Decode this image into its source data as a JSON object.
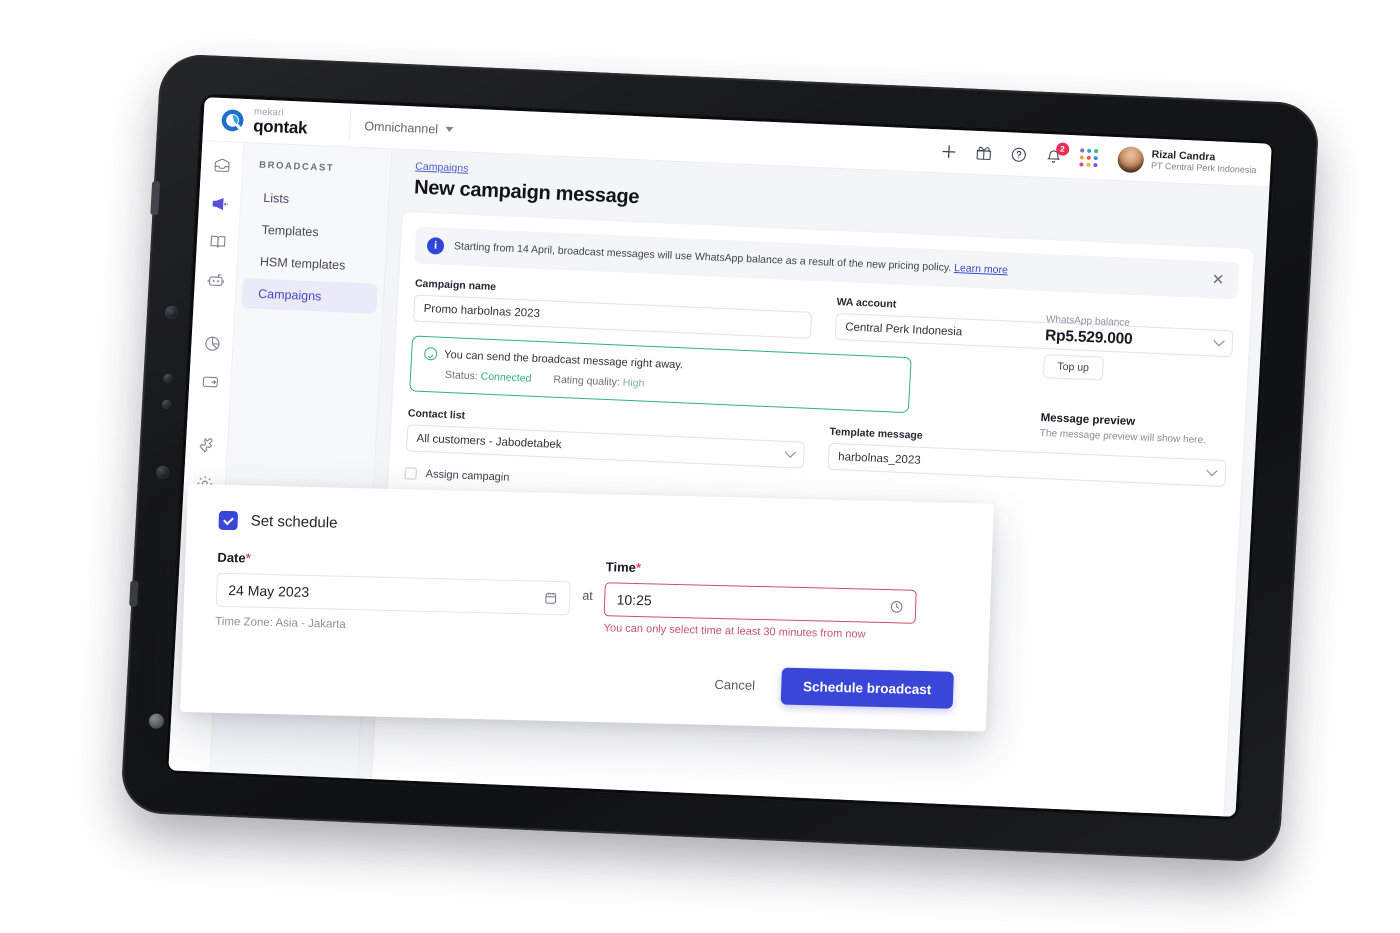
{
  "brand": {
    "small": "mekari",
    "main": "qontak",
    "logo_icon": "qontak-logo-icon"
  },
  "topbar": {
    "workspace_label": "Omnichannel",
    "icons": [
      {
        "name": "plus-icon"
      },
      {
        "name": "gift-icon"
      },
      {
        "name": "help-circle-icon"
      },
      {
        "name": "bell-icon",
        "badge": "2"
      },
      {
        "name": "app-grid-icon"
      }
    ],
    "user": {
      "name": "Rizal Candra",
      "org": "PT Central Perk Indonesia"
    }
  },
  "rail": {
    "items": [
      {
        "name": "inbox-icon",
        "active": false
      },
      {
        "name": "megaphone-icon",
        "active": true
      },
      {
        "name": "book-icon",
        "active": false
      },
      {
        "name": "robot-icon",
        "active": false
      },
      {
        "name": "pie-chart-icon",
        "active": false
      },
      {
        "name": "wallet-icon",
        "active": false
      },
      {
        "name": "puzzle-icon",
        "active": false
      },
      {
        "name": "gear-icon",
        "active": false
      }
    ]
  },
  "sidebar": {
    "title": "BROADCAST",
    "items": [
      {
        "label": "Lists",
        "active": false
      },
      {
        "label": "Templates",
        "active": false
      },
      {
        "label": "HSM templates",
        "active": false
      },
      {
        "label": "Campaigns",
        "active": true
      }
    ]
  },
  "main": {
    "breadcrumb": "Campaigns",
    "page_title": "New campaign message",
    "notice": {
      "text": "Starting from 14 April, broadcast messages will use WhatsApp balance as a result of the new pricing policy.",
      "link": "Learn more",
      "close": "✕"
    },
    "campaign_name": {
      "label": "Campaign name",
      "value": "Promo harbolnas 2023"
    },
    "wa_account": {
      "label": "WA account",
      "value": "Central Perk Indonesia"
    },
    "status_box": {
      "message": "You can send the broadcast message right away.",
      "status_label": "Status:",
      "status_value": "Connected",
      "rating_label": "Rating quality:",
      "rating_value": "High"
    },
    "contact_list": {
      "label": "Contact list",
      "value": "All customers - Jabodetabek"
    },
    "template_message": {
      "label": "Template message",
      "value": "harbolnas_2023"
    },
    "assign_campaign": {
      "label": "Assign campagin",
      "checked": false
    }
  },
  "right": {
    "balance_label": "WhatsApp balance",
    "balance_value": "Rp5.529.000",
    "topup_label": "Top up",
    "preview_title": "Message preview",
    "preview_sub": "The message preview will show here."
  },
  "modal": {
    "set_schedule_label": "Set schedule",
    "set_schedule_checked": true,
    "date_label": "Date",
    "date_required": "*",
    "date_value": "24 May 2023",
    "date_icon": "calendar-icon",
    "timezone": "Time Zone: Asia - Jakarta",
    "at_label": "at",
    "time_label": "Time",
    "time_required": "*",
    "time_value": "10:25",
    "time_icon": "clock-icon",
    "time_error": "You can only select time at least 30 minutes from now",
    "cancel_label": "Cancel",
    "submit_label": "Schedule broadcast"
  },
  "colors": {
    "accent": "#3a46d8",
    "sidebar_active": "#4b46c6",
    "success": "#31b27c",
    "error": "#c9516a",
    "badge": "#e8305a"
  }
}
